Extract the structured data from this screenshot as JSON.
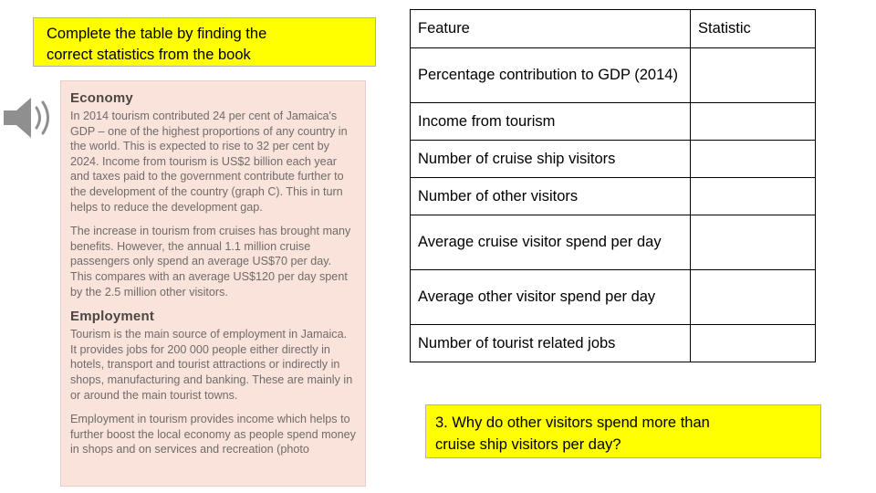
{
  "instruction": {
    "line1": "Complete the table by finding the",
    "line2": "correct statistics from the book"
  },
  "icons": {
    "speaker": "speaker-icon"
  },
  "book_extract": {
    "heading1": "Economy",
    "para1": "In 2014 tourism contributed 24 per cent of Jamaica's GDP – one of the highest proportions of any country in the world. This is expected to rise to 32 per cent by 2024. Income from tourism is US$2 billion each year and taxes paid to the government contribute further to the development of the country (graph C). This in turn helps to reduce the development gap.",
    "para2": "The increase in tourism from cruises has brought many benefits. However, the annual 1.1 million cruise passengers only spend an average US$70 per day. This compares with an average US$120 per day spent by the 2.5 million other visitors.",
    "heading2": "Employment",
    "para3": "Tourism is the main source of employment in Jamaica. It provides jobs for 200 000 people either directly in hotels, transport and tourist attractions or indirectly in shops, manufacturing and banking. These are mainly in or around the main tourist towns.",
    "para4": "Employment in tourism provides income which helps to further boost the local economy as people spend money in shops and on services and recreation (photo"
  },
  "table": {
    "headers": {
      "feature": "Feature",
      "statistic": "Statistic"
    },
    "rows": [
      {
        "feature": "Percentage contribution to GDP (2014)",
        "statistic": ""
      },
      {
        "feature": "Income from tourism",
        "statistic": ""
      },
      {
        "feature": "Number of cruise ship visitors",
        "statistic": ""
      },
      {
        "feature": "Number of other visitors",
        "statistic": ""
      },
      {
        "feature": "Average cruise visitor spend per day",
        "statistic": ""
      },
      {
        "feature": "Average other visitor spend per day",
        "statistic": ""
      },
      {
        "feature": "Number of tourist related jobs",
        "statistic": ""
      }
    ]
  },
  "question": {
    "line1": "3.  Why do other visitors spend more than",
    "line2": "cruise ship visitors per day?"
  },
  "colors": {
    "highlight": "#ffff00",
    "extract_background": "#fae3da",
    "border": "#000000"
  }
}
